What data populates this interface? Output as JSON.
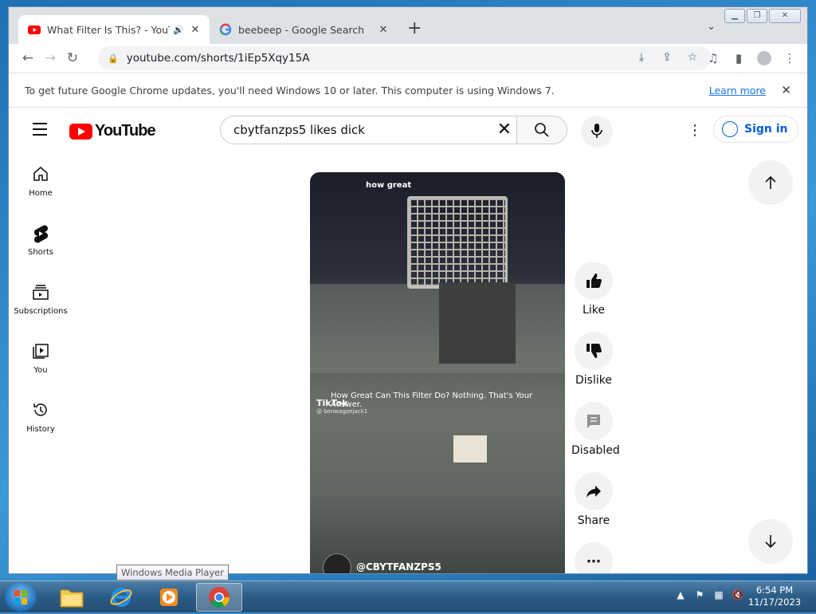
{
  "browser": {
    "tabs": [
      {
        "title": "What Filter Is This? - YouTube",
        "active": true,
        "favicon": "youtube-icon",
        "audio": true
      },
      {
        "title": "beebeep - Google Search",
        "active": false,
        "favicon": "google-icon"
      }
    ],
    "new_tab": "+",
    "url": "youtube.com/shorts/1iEp5Xqy15A",
    "infobar": {
      "message": "To get future Google Chrome updates, you'll need Windows 10 or later. This computer is using Windows 7.",
      "learn_more": "Learn more"
    }
  },
  "youtube": {
    "logo_text": "YouTube",
    "search_query": "cbytfanzps5 likes dick",
    "sign_in": "Sign in",
    "guide": [
      {
        "label": "Home",
        "icon": "home-icon"
      },
      {
        "label": "Shorts",
        "icon": "shorts-icon"
      },
      {
        "label": "Subscriptions",
        "icon": "subscriptions-icon"
      },
      {
        "label": "You",
        "icon": "you-icon"
      },
      {
        "label": "History",
        "icon": "history-icon"
      }
    ],
    "short": {
      "overlay_top": "how great",
      "overlay_caption": "How Great Can This Filter Do? Nothing. That's Your Answer.",
      "tiktok": "TikTok",
      "tiktok_handle": "@ bonwagonjack1",
      "channel": "@CBYTFANZPS5"
    },
    "actions": [
      {
        "label": "Like",
        "icon": "thumbs-up-icon"
      },
      {
        "label": "Dislike",
        "icon": "thumbs-down-icon"
      },
      {
        "label": "Disabled",
        "icon": "comments-icon"
      },
      {
        "label": "Share",
        "icon": "share-icon"
      },
      {
        "label": "",
        "icon": "more-icon"
      }
    ]
  },
  "taskbar": {
    "tooltip": "Windows Media Player",
    "clock_time": "6:54 PM",
    "clock_date": "11/17/2023"
  }
}
